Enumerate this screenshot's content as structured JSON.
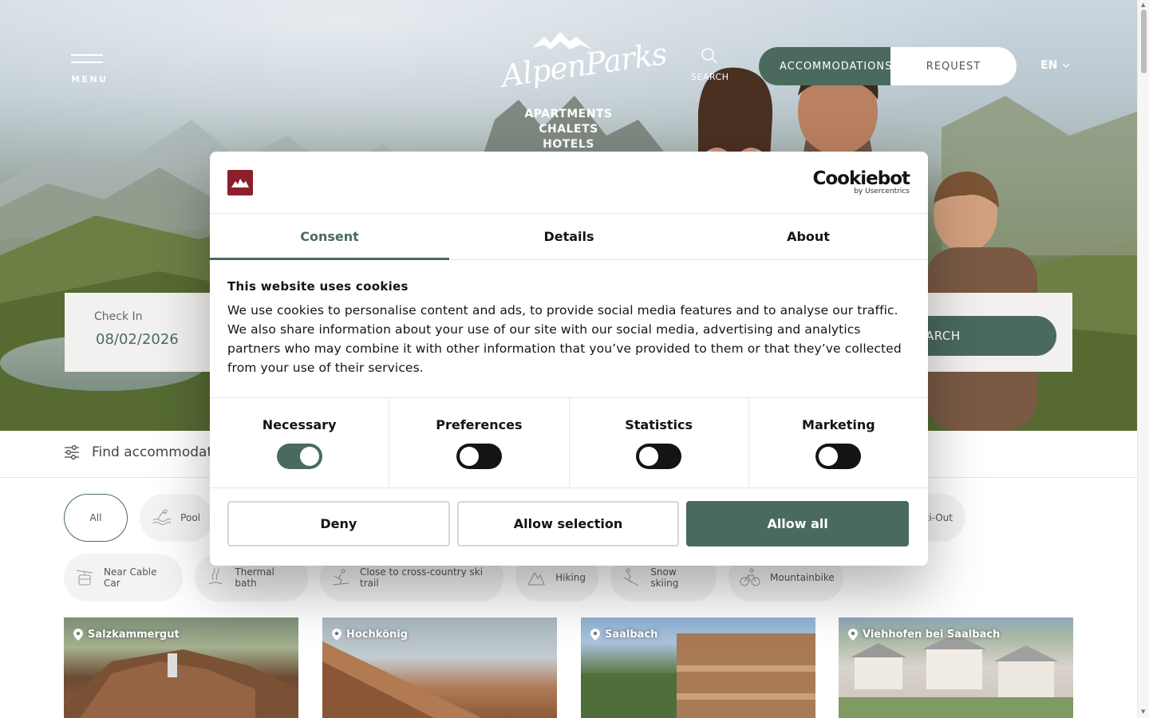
{
  "header": {
    "menu_label": "MENU",
    "logo_text": "AlpenParks",
    "logo_sub": [
      "APARTMENTS",
      "CHALETS",
      "HOTELS"
    ],
    "search_label": "SEARCH",
    "accommodations_label": "ACCOMMODATIONS",
    "request_label": "REQUEST",
    "language": "EN"
  },
  "booking": {
    "checkin_label": "Check In",
    "checkin_value": "08/02/2026",
    "search_button_label": "SEARCH"
  },
  "filters": {
    "find_label": "Find accommodation",
    "chips_row1": [
      {
        "label": "All",
        "icon": "none"
      },
      {
        "label": "Pool",
        "icon": "pool-icon"
      },
      {
        "label": "Ski-In / Ski-Out",
        "icon": "ski-icon"
      }
    ],
    "chips_row2": [
      {
        "label": "Near Cable Car",
        "icon": "cable-car-icon"
      },
      {
        "label": "Thermal bath",
        "icon": "thermal-bath-icon"
      },
      {
        "label": "Close to cross-country ski trail",
        "icon": "cross-country-ski-icon"
      },
      {
        "label": "Hiking",
        "icon": "hiking-icon"
      },
      {
        "label": "Snow skiing",
        "icon": "snow-skiing-icon"
      },
      {
        "label": "Mountainbike",
        "icon": "mountainbike-icon"
      }
    ]
  },
  "cards": [
    {
      "location": "Salzkammergut"
    },
    {
      "location": "Hochkönig"
    },
    {
      "location": "Saalbach"
    },
    {
      "location": "Viehhofen bei Saalbach"
    }
  ],
  "cookie_dialog": {
    "brand": "Cookiebot",
    "brand_by": "by Usercentrics",
    "tabs": [
      "Consent",
      "Details",
      "About"
    ],
    "title": "This website uses cookies",
    "text": "We use cookies to personalise content and ads, to provide social media features and to analyse our traffic. We also share information about your use of our site with our social media, advertising and analytics partners who may combine it with other information that you’ve provided to them or that they’ve collected from your use of their services.",
    "toggles": [
      {
        "label": "Necessary",
        "on": true
      },
      {
        "label": "Preferences",
        "on": false
      },
      {
        "label": "Statistics",
        "on": false
      },
      {
        "label": "Marketing",
        "on": false
      }
    ],
    "buttons": {
      "deny": "Deny",
      "allow_selection": "Allow selection",
      "allow_all": "Allow all"
    }
  },
  "colors": {
    "accent": "#4a6a5e",
    "brand_red": "#8b1f2c"
  }
}
